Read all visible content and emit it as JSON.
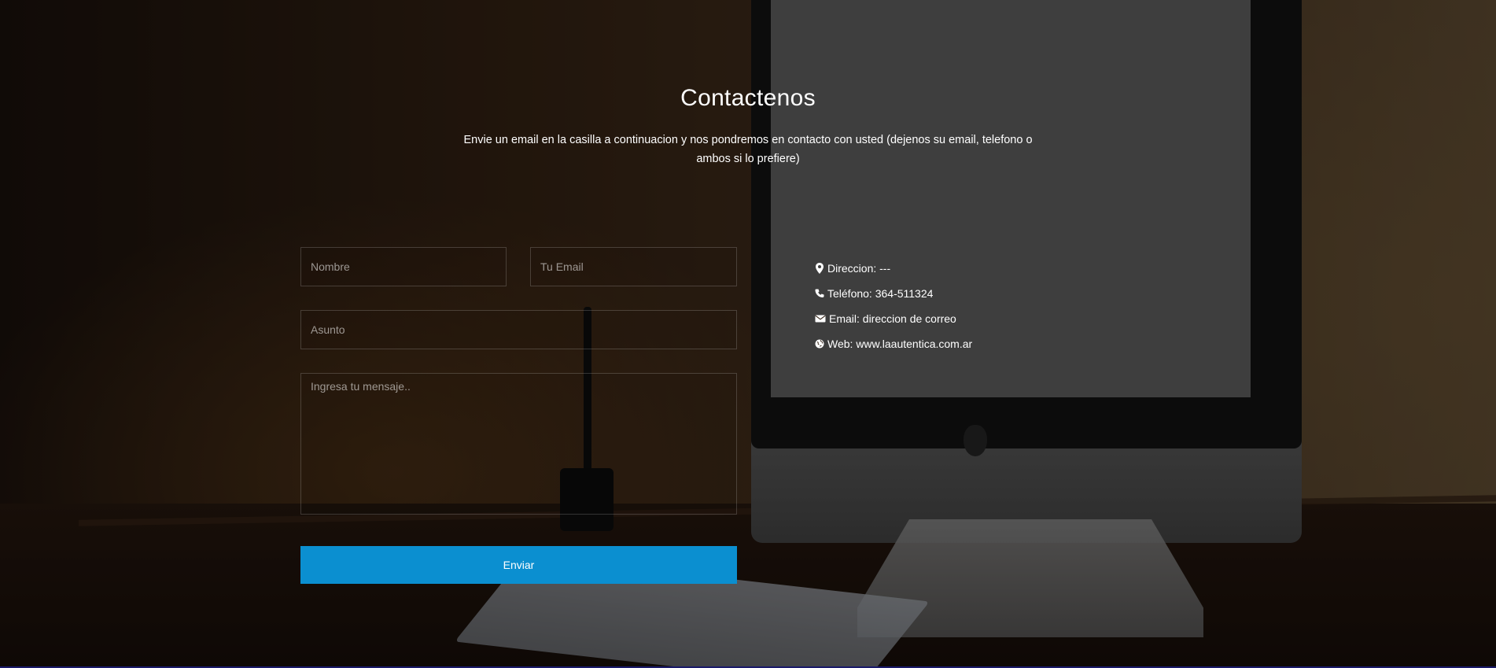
{
  "section": {
    "title": "Contactenos",
    "subtitle": "Envie un email en la casilla a continuacion y nos pondremos en contacto con usted (dejenos su email, telefono o ambos si lo prefiere)"
  },
  "form": {
    "name_placeholder": "Nombre",
    "email_placeholder": "Tu Email",
    "subject_placeholder": "Asunto",
    "message_placeholder": "Ingresa tu mensaje..",
    "submit_label": "Enviar",
    "submit_color": "#0b8fd0"
  },
  "contact_info": [
    {
      "icon": "map-marker-icon",
      "text": "Direccion: ---"
    },
    {
      "icon": "phone-icon",
      "text": "Teléfono: 364-511324"
    },
    {
      "icon": "envelope-icon",
      "text": "Email: direccion de correo"
    },
    {
      "icon": "globe-icon",
      "text": "Web: www.laautentica.com.ar"
    }
  ]
}
